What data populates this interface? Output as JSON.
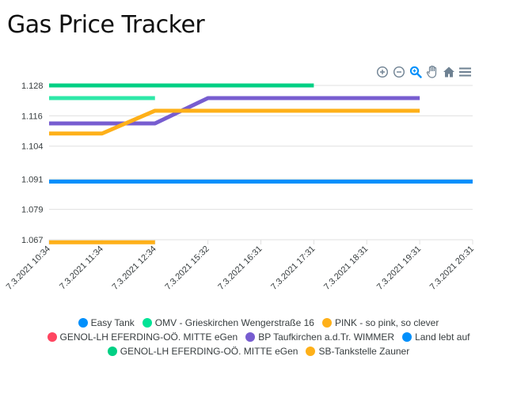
{
  "page": {
    "title": "Gas Price Tracker"
  },
  "toolbar": {
    "icons": [
      "zoom-in-icon",
      "zoom-out-icon",
      "zoom-selection-icon",
      "pan-hand-icon",
      "reset-home-icon",
      "menu-icon"
    ],
    "active_color": "#008ffb",
    "inactive_color": "#6e8192"
  },
  "chart_data": {
    "type": "line",
    "curve": "straight",
    "y_ticks": [
      "1.128",
      "1.116",
      "1.104",
      "1.091",
      "1.079",
      "1.067"
    ],
    "y_tick_values": [
      1.128,
      1.116,
      1.104,
      1.091,
      1.079,
      1.067
    ],
    "ylim": [
      1.067,
      1.128
    ],
    "x_ticks": [
      "7.3.2021 10:34",
      "7.3.2021 11:34",
      "7.3.2021 12:34",
      "7.3.2021 15:32",
      "7.3.2021 16:31",
      "7.3.2021 17:31",
      "7.3.2021 18:31",
      "7.3.2021 19:31",
      "7.3.2021 20:31"
    ],
    "grid": "horizontal",
    "legend_position": "bottom",
    "series": [
      {
        "name": "Easy Tank",
        "color": "#008ffb",
        "x": [],
        "y": []
      },
      {
        "name": "OMV - Grieskirchen Wengerstraße 16",
        "color": "#00e396",
        "x": [],
        "y": []
      },
      {
        "name": "PINK - so pink, so clever",
        "color": "#feb019",
        "x": [],
        "y": []
      },
      {
        "name": "GENOL-LH EFERDING-OÖ. MITTE eGen",
        "color": "#ff4560",
        "x": [],
        "y": []
      },
      {
        "name": "BP Taufkirchen a.d.Tr. WIMMER",
        "color": "#775dd0",
        "x": [
          0,
          2,
          3,
          7
        ],
        "y": [
          1.113,
          1.113,
          1.123,
          1.123
        ]
      },
      {
        "name": "Land lebt auf",
        "color": "#008ffb",
        "x": [
          0,
          8
        ],
        "y": [
          1.09,
          1.09
        ]
      },
      {
        "name": "GENOL-LH EFERDING-OÖ. MITTE eGen",
        "color": "#00d084",
        "x": [
          0,
          5
        ],
        "y": [
          1.128,
          1.128
        ]
      },
      {
        "name": "SB-Tankstelle Zauner",
        "color": "#feb019",
        "x": [
          0,
          1,
          2,
          7
        ],
        "y": [
          1.109,
          1.109,
          1.118,
          1.118
        ]
      },
      {
        "name": "",
        "color": "#2ee8a8",
        "x": [
          0,
          2
        ],
        "y": [
          1.123,
          1.123
        ]
      },
      {
        "name": "",
        "color": "#feb019",
        "x": [
          0,
          2
        ],
        "y": [
          1.066,
          1.066
        ]
      }
    ]
  },
  "legend": {
    "rows": [
      [
        {
          "label": "Easy Tank",
          "color": "#008ffb"
        },
        {
          "label": "OMV - Grieskirchen Wengerstraße 16",
          "color": "#00e396"
        },
        {
          "label": "PINK - so pink, so clever",
          "color": "#feb019"
        }
      ],
      [
        {
          "label": "GENOL-LH EFERDING-OÖ. MITTE eGen",
          "color": "#ff4560"
        },
        {
          "label": "BP Taufkirchen a.d.Tr. WIMMER",
          "color": "#775dd0"
        },
        {
          "label": "Land lebt auf",
          "color": "#008ffb"
        }
      ],
      [
        {
          "label": "GENOL-LH EFERDING-OÖ. MITTE eGen",
          "color": "#00d084"
        },
        {
          "label": "SB-Tankstelle Zauner",
          "color": "#feb019"
        }
      ]
    ]
  }
}
